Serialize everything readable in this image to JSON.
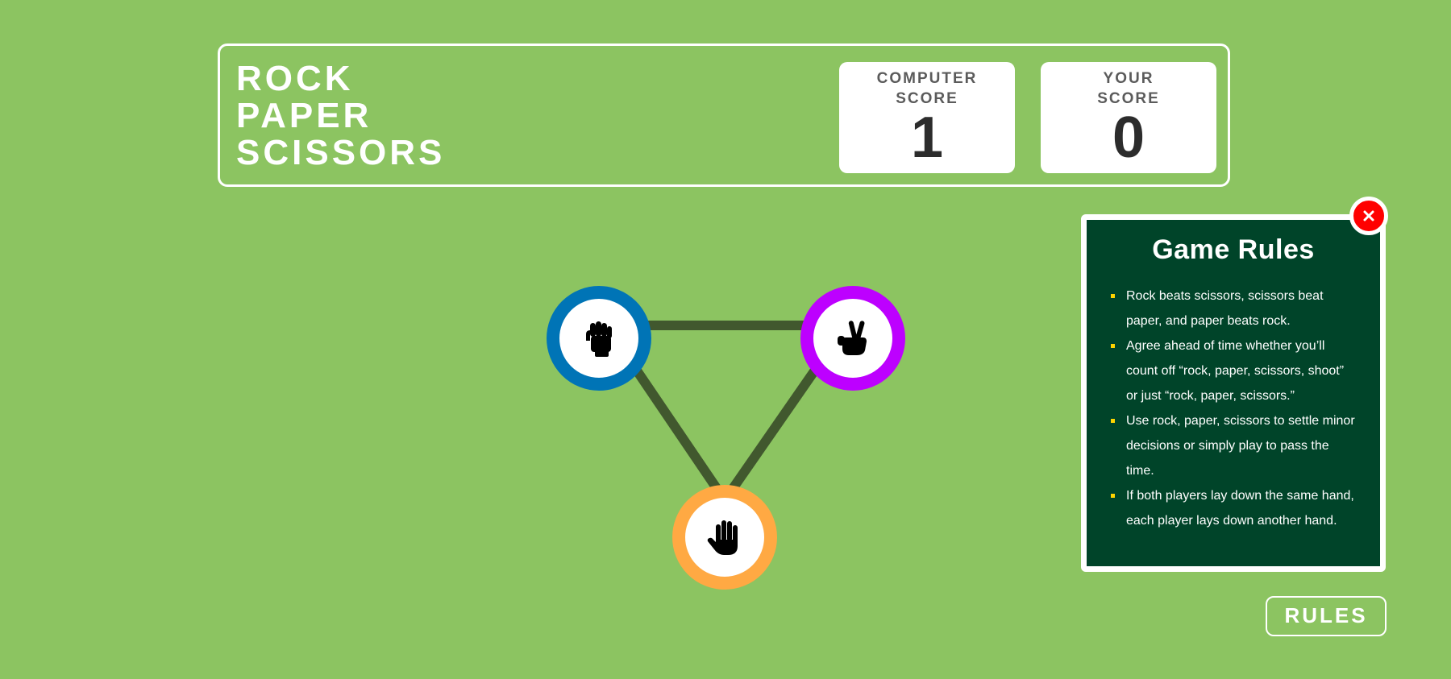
{
  "header": {
    "title_lines": [
      "ROCK",
      "PAPER",
      "SCISSORS"
    ],
    "computer_score_label": "COMPUTER\nSCORE",
    "computer_score": "1",
    "user_score_label": "YOUR\nSCORE",
    "user_score": "0"
  },
  "board": {
    "choices": [
      {
        "name": "rock",
        "icon": "fist-icon",
        "ring_color": "#0074b6"
      },
      {
        "name": "scissors",
        "icon": "victory-hand-icon",
        "ring_color": "#bd00ff"
      },
      {
        "name": "paper",
        "icon": "open-hand-icon",
        "ring_color": "#ffa943"
      }
    ]
  },
  "rules": {
    "title": "Game Rules",
    "items": [
      "Rock beats scissors, scissors beat paper, and paper beats rock.",
      "Agree ahead of time whether you’ll count off “rock, paper, scissors, shoot” or just “rock, paper, scissors.”",
      "Use rock, paper, scissors to settle minor decisions or simply play to pass the time.",
      "If both players lay down the same hand, each player lays down another hand."
    ],
    "close_icon": "close-icon",
    "button_label": "RULES"
  },
  "colors": {
    "background": "#8cc461",
    "panel": "#004429",
    "close": "#ff0000",
    "bullet": "#ffd400"
  }
}
